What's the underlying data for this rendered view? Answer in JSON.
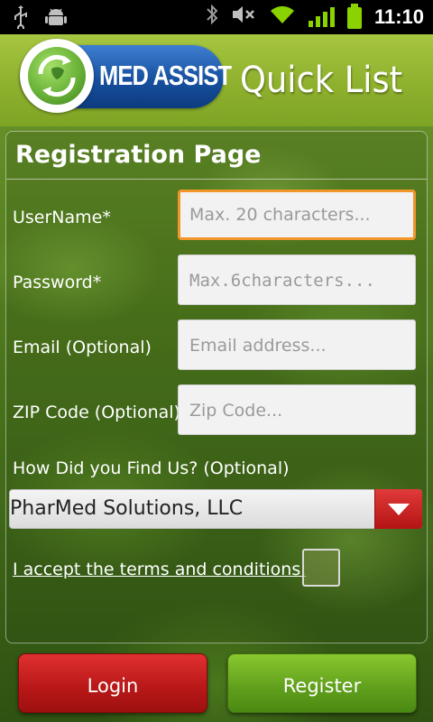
{
  "status_bar": {
    "time": "11:10",
    "icons": [
      "usb-icon",
      "android-debug-icon",
      "bluetooth-icon",
      "mute-icon",
      "wifi-icon",
      "signal-icon",
      "battery-icon"
    ]
  },
  "header": {
    "logo_text": "MED ASSIST",
    "title": "Quick List"
  },
  "form": {
    "title": "Registration Page",
    "fields": [
      {
        "label": "UserName*",
        "placeholder": "Max. 20 characters..."
      },
      {
        "label": "Password*",
        "placeholder": "Max.6characters..."
      },
      {
        "label": "Email (Optional)",
        "placeholder": "Email address..."
      },
      {
        "label": "ZIP Code (Optional)",
        "placeholder": "Zip Code..."
      }
    ],
    "how_label": "How Did you Find Us? (Optional)",
    "how_selected": "PharMed Solutions, LLC",
    "terms_label": "I accept the terms and conditions.",
    "terms_checked": false
  },
  "buttons": {
    "login": "Login",
    "register": "Register"
  },
  "colors": {
    "focus_border": "#f0962a",
    "login_button": "#c41c1c",
    "register_button": "#6aa820",
    "header_green": "#90b22e"
  }
}
